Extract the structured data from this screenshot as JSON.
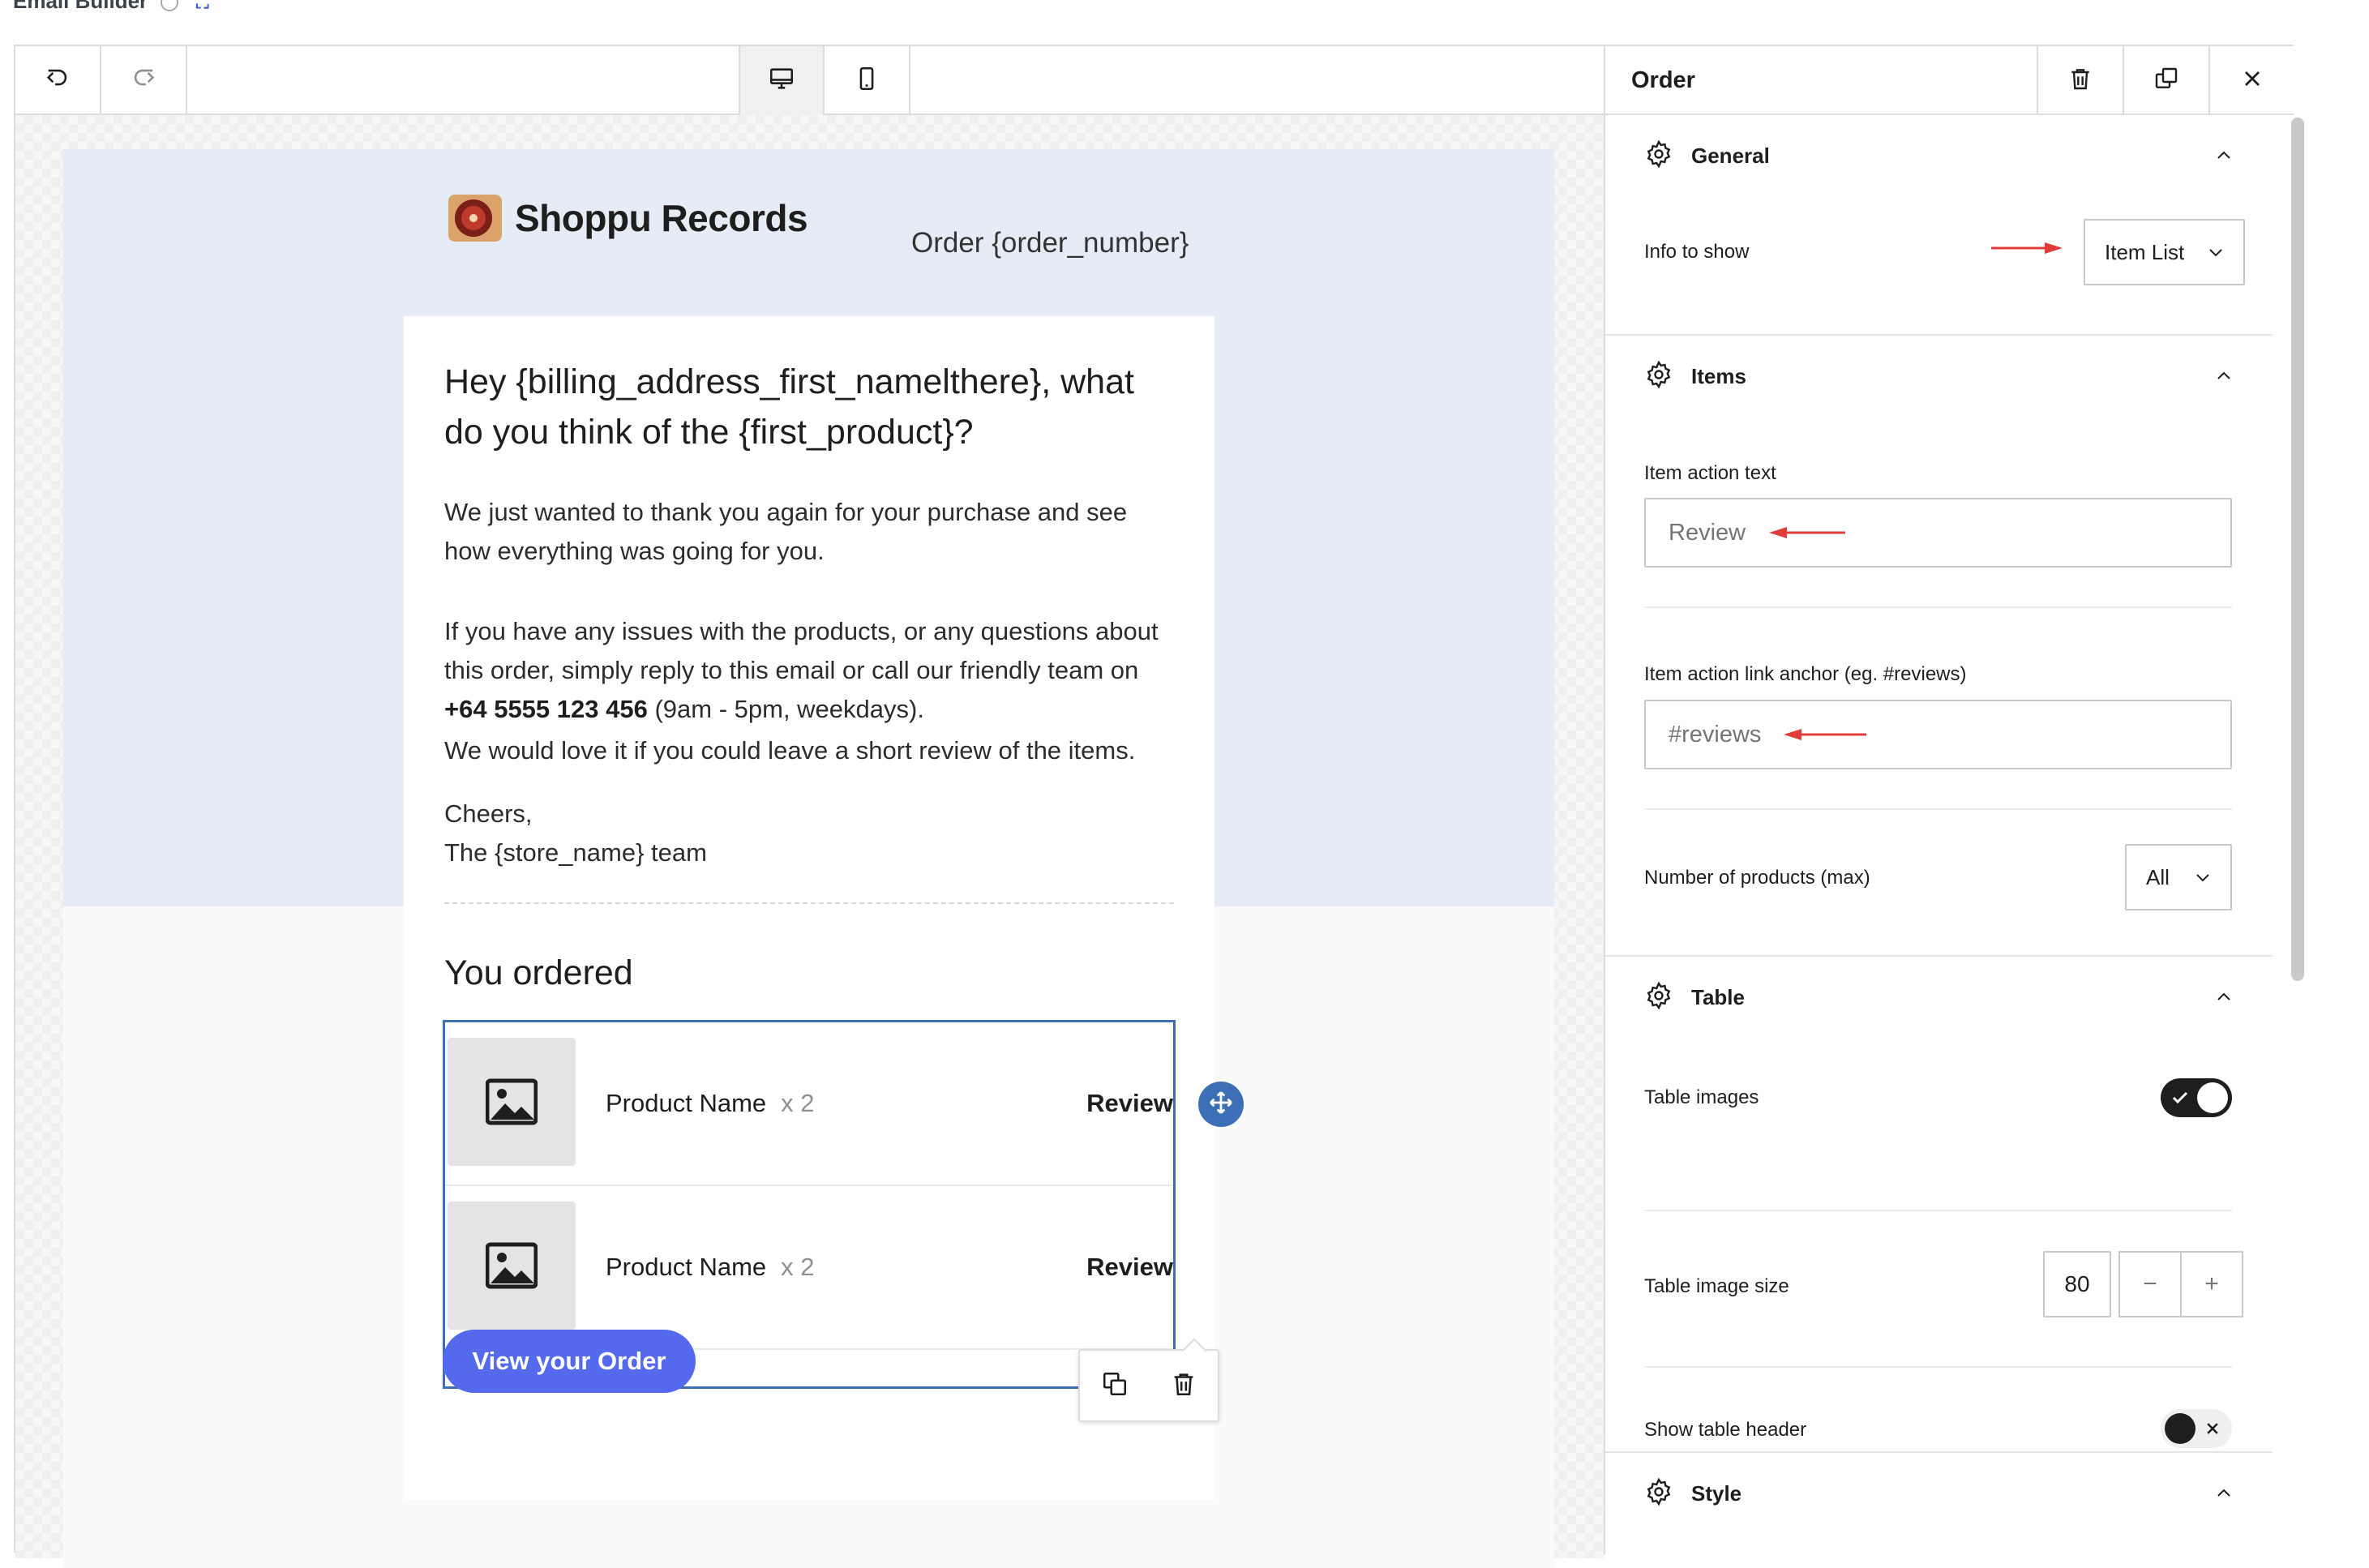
{
  "page": {
    "title": "Email Builder"
  },
  "toolbar": {
    "undo_icon": "undo-icon",
    "redo_icon": "redo-icon",
    "desktop_icon": "desktop-icon",
    "mobile_icon": "mobile-icon"
  },
  "email": {
    "brand": "Shoppu Records",
    "order_number": "Order {order_number}",
    "heading": "Hey {billing_address_first_namelthere}, what do you think of the {first_product}?",
    "para1": "We just wanted to thank you again for your purchase and see how everything was going for you.",
    "para2_prefix": "If you have any issues with the products, or any questions about this order, simply reply to this email or call our friendly team on ",
    "para2_phone": "+64 5555 123 456",
    "para2_suffix": " (9am - 5pm, weekdays).",
    "para3": "We would love it if you could leave a short review of the items.",
    "signoff_line1": "Cheers,",
    "signoff_line2": "The {store_name} team",
    "you_ordered": "You ordered",
    "products": [
      {
        "name": "Product Name",
        "qty": "x 2",
        "action": "Review"
      },
      {
        "name": "Product Name",
        "qty": "x 2",
        "action": "Review"
      }
    ],
    "cta": "View your Order"
  },
  "panel": {
    "title": "Order",
    "general": {
      "title": "General",
      "info_label": "Info to show",
      "info_value": "Item List"
    },
    "items": {
      "title": "Items",
      "action_text_label": "Item action text",
      "action_text_placeholder": "Review",
      "anchor_label": "Item action link anchor (eg. #reviews)",
      "anchor_placeholder": "#reviews",
      "max_label": "Number of products (max)",
      "max_value": "All"
    },
    "table": {
      "title": "Table",
      "images_label": "Table images",
      "images_on": true,
      "image_size_label": "Table image size",
      "image_size_value": "80",
      "header_label": "Show table header",
      "header_on": false
    },
    "style": {
      "title": "Style"
    }
  },
  "colors": {
    "accent": "#3d6fb6",
    "cta": "#5569ec",
    "header_bg": "#e6ecf5",
    "annotation_arrow": "#e03c3c"
  }
}
